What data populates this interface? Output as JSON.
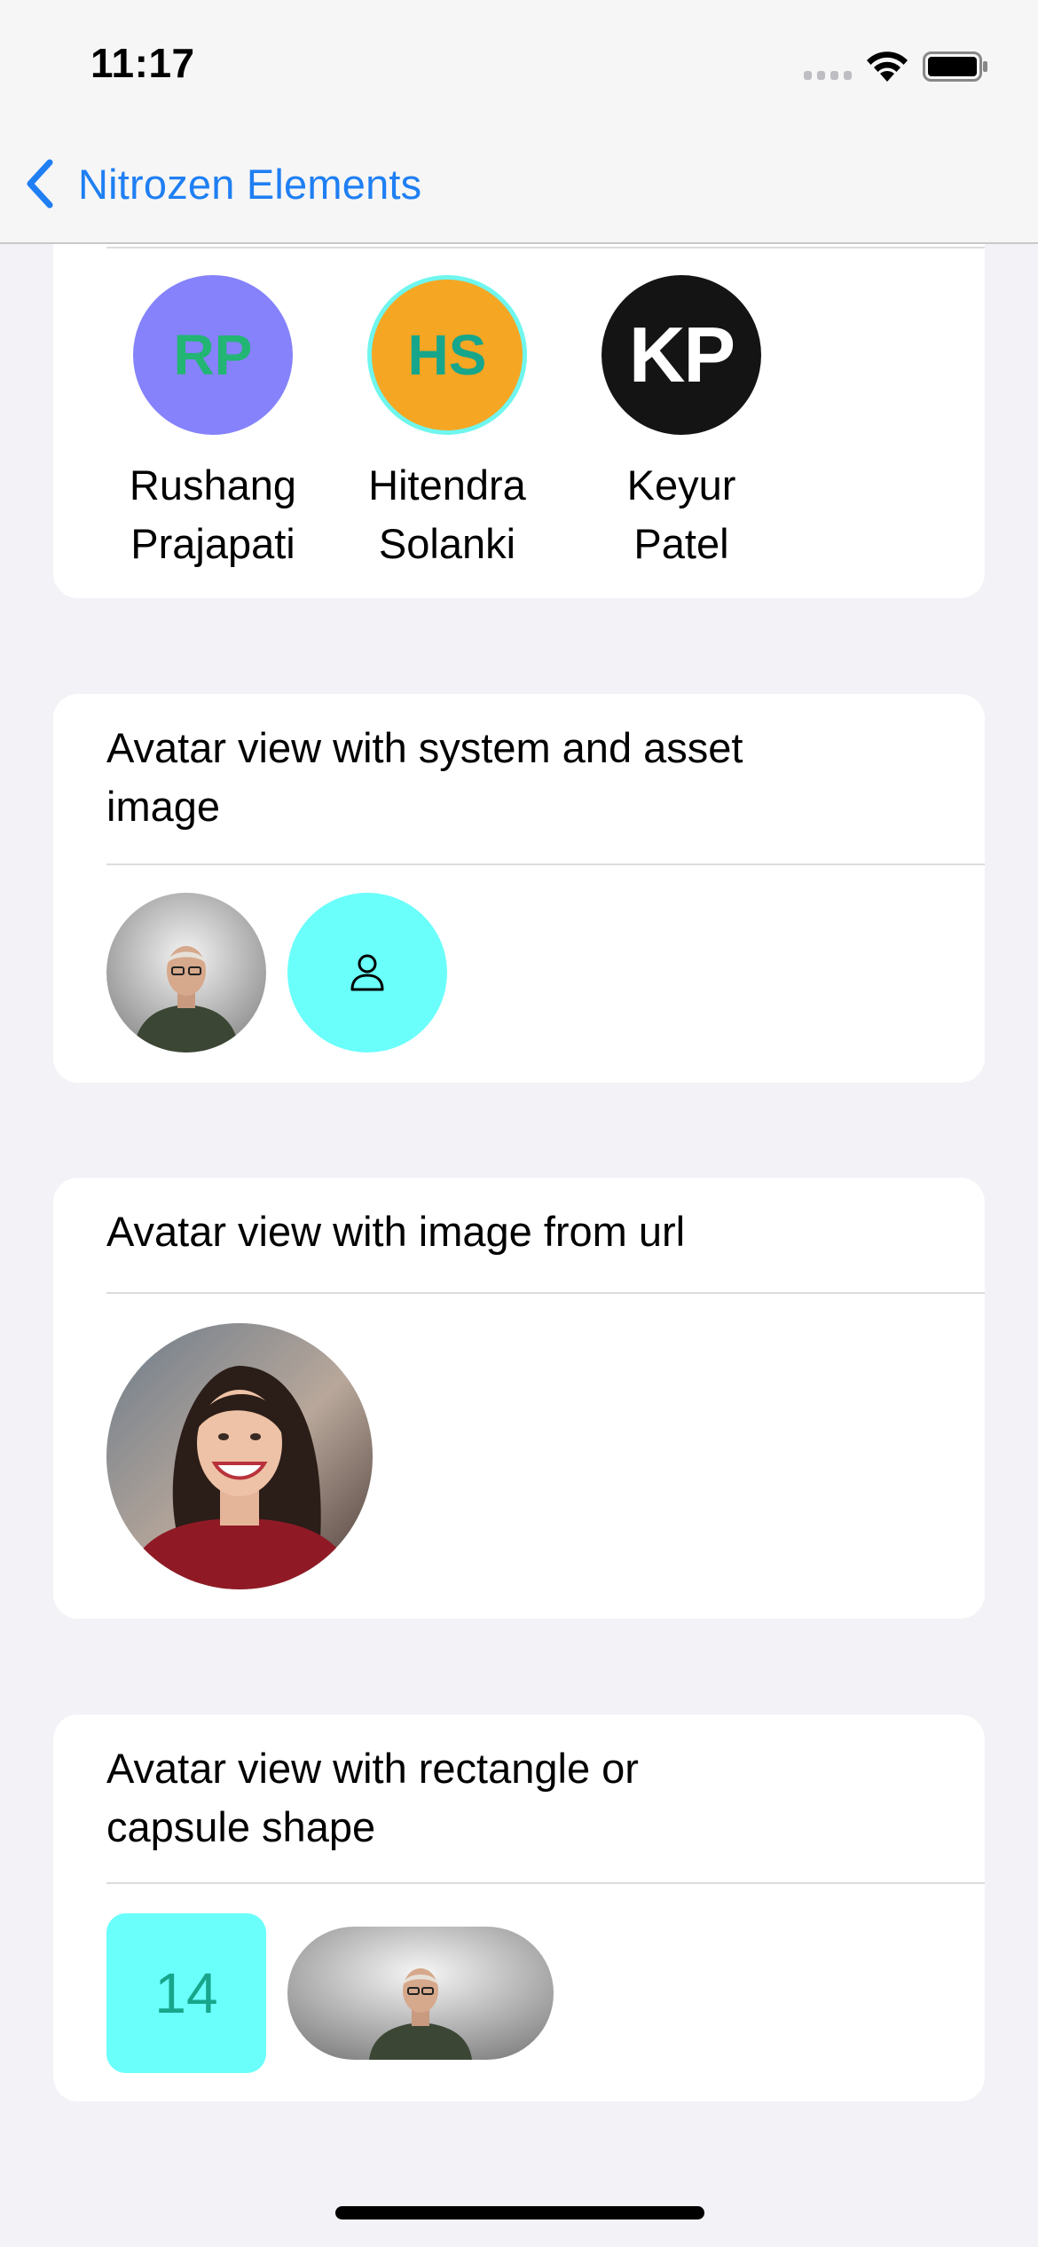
{
  "status_bar": {
    "time": "11:17"
  },
  "nav": {
    "back_label": "Nitrozen Elements"
  },
  "card_initials": {
    "avatars": [
      {
        "initials": "RP",
        "first": "Rushang",
        "last": "Prajapati",
        "bg": "#8582fb",
        "fg": "#22b573",
        "border": ""
      },
      {
        "initials": "HS",
        "first": "Hitendra",
        "last": "Solanki",
        "bg": "#f5a623",
        "fg": "#17a68b",
        "border": "#6ff6ee"
      },
      {
        "initials": "KP",
        "first": "Keyur",
        "last": "Patel",
        "bg": "#141414",
        "fg": "#ffffff",
        "border": ""
      }
    ]
  },
  "card_system": {
    "title": "Avatar view with system and asset image",
    "system_bg": "#6afffb"
  },
  "card_url": {
    "title": "Avatar view with image from url"
  },
  "card_shape": {
    "title": "Avatar view with rectangle or capsule shape",
    "badge_number": "14",
    "badge_bg": "#6afffb",
    "badge_fg": "#17a68b"
  },
  "colors": {
    "accent": "#1f7ff3",
    "background": "#f2f2f7"
  },
  "icons": [
    "chevron-left-icon",
    "person-icon",
    "wifi-icon",
    "battery-icon",
    "cellular-signal-icon"
  ]
}
